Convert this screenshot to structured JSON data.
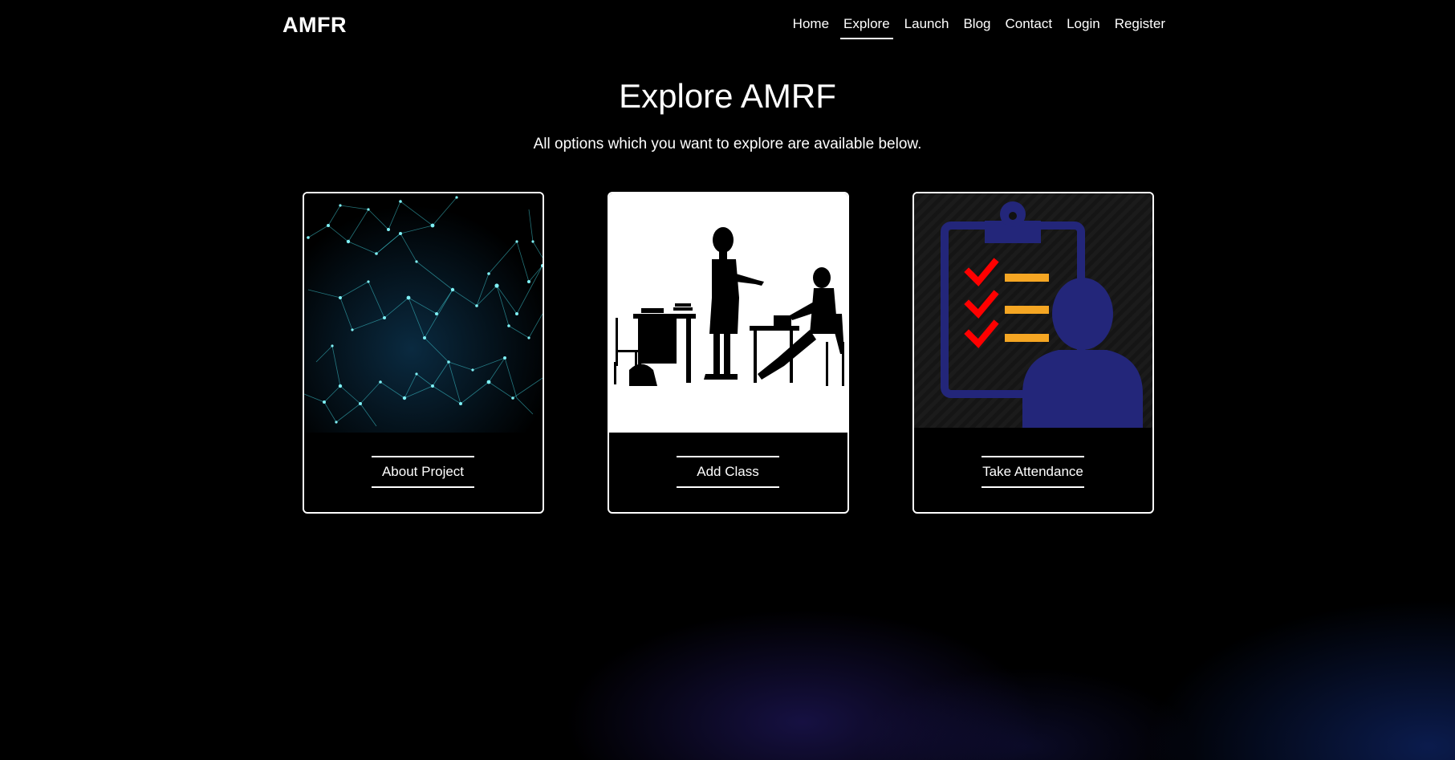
{
  "brand": "AMFR",
  "nav": {
    "items": [
      "Home",
      "Explore",
      "Launch",
      "Blog",
      "Contact",
      "Login",
      "Register"
    ],
    "active": "Explore"
  },
  "hero": {
    "title": "Explore AMRF",
    "subtitle": "All options which you want to explore are available below."
  },
  "cards": [
    {
      "button_label": "About Project",
      "image": "network-mesh-image"
    },
    {
      "button_label": "Add Class",
      "image": "teacher-student-silhouette-image"
    },
    {
      "button_label": "Take Attendance",
      "image": "attendance-clipboard-icon"
    }
  ],
  "colors": {
    "background": "#000000",
    "text": "#ffffff",
    "network": "#3fd0d8",
    "clipboard": "#23267a",
    "check": "#ff0000",
    "line": "#f5a623"
  }
}
